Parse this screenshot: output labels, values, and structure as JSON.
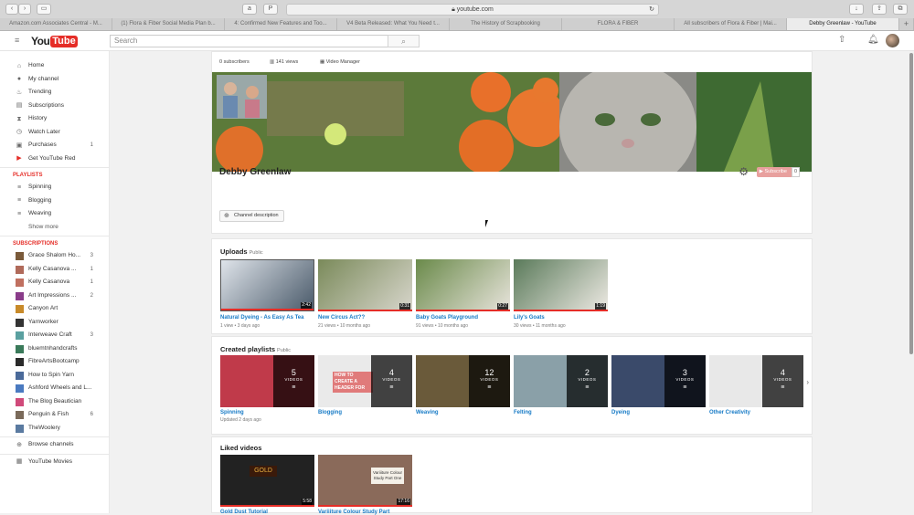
{
  "browser": {
    "url": "youtube.com",
    "tabs": [
      "Amazon.com Associates Central - M...",
      "(1) Flora & Fiber Social Media Plan b...",
      "4: Confirmed New Features and Too...",
      "V4 Beta Released: What You Need t...",
      "The History of Scrapbooking",
      "FLORA & FIBER",
      "All subscribers of Flora & Fiber | Mai...",
      "Debby Greenlaw - YouTube"
    ]
  },
  "header": {
    "logo_you": "You",
    "logo_tube": "Tube",
    "search_placeholder": "Search"
  },
  "sidebar": {
    "main": [
      {
        "label": "Home",
        "icon": "home-icon",
        "glyph": "⌂"
      },
      {
        "label": "My channel",
        "icon": "user-icon",
        "glyph": "●"
      },
      {
        "label": "Trending",
        "icon": "flame-icon",
        "glyph": "♨"
      },
      {
        "label": "Subscriptions",
        "icon": "subscriptions-icon",
        "glyph": "▤"
      },
      {
        "label": "History",
        "icon": "hourglass-icon",
        "glyph": "⧗"
      },
      {
        "label": "Watch Later",
        "icon": "clock-icon",
        "glyph": "◷"
      },
      {
        "label": "Purchases",
        "icon": "purchases-icon",
        "glyph": "▣",
        "count": "1"
      },
      {
        "label": "Get YouTube Red",
        "icon": "youtube-red-icon",
        "glyph": "▶"
      }
    ],
    "playlists_title": "PLAYLISTS",
    "playlists": [
      {
        "label": "Spinning"
      },
      {
        "label": "Blogging"
      },
      {
        "label": "Weaving"
      }
    ],
    "show_more": "Show more",
    "subscriptions_title": "SUBSCRIPTIONS",
    "subscriptions": [
      {
        "label": "Grace Shalom Ho...",
        "count": "3",
        "color": "#7a5a3a"
      },
      {
        "label": "Kelly Casanova ...",
        "count": "1",
        "color": "#b06a5a"
      },
      {
        "label": "Kelly Casanova",
        "count": "1",
        "color": "#c07060"
      },
      {
        "label": "Art Impressions ...",
        "count": "2",
        "color": "#8a3c8a"
      },
      {
        "label": "Canyon Art",
        "count": "",
        "color": "#c88a2a"
      },
      {
        "label": "Yarnworker",
        "count": "",
        "color": "#333333"
      },
      {
        "label": "Interweave Craft",
        "count": "3",
        "color": "#5aa0a0"
      },
      {
        "label": "bluemtnhandcrafts",
        "count": "",
        "color": "#3a7a5a"
      },
      {
        "label": "FibreArtsBootcamp",
        "count": "",
        "color": "#2a2a2a"
      },
      {
        "label": "How to Spin Yarn",
        "count": "",
        "color": "#4a6a9a"
      },
      {
        "label": "Ashford Wheels and L...",
        "count": "",
        "color": "#4a7ac0"
      },
      {
        "label": "The Blog Beautician",
        "count": "",
        "color": "#d04a7a"
      },
      {
        "label": "Penguin & Fish",
        "count": "6",
        "color": "#7a6a5a"
      },
      {
        "label": "TheWoolery",
        "count": "",
        "color": "#5a7aa0"
      }
    ],
    "browse_channels": "Browse channels",
    "youtube_movies": "YouTube Movies"
  },
  "channel": {
    "subscribers": "0 subscribers",
    "views": "141 views",
    "video_manager": "Video Manager",
    "name": "Debby Greenlaw",
    "subscribe_label": "Subscribe",
    "subscribe_count": "0",
    "description_button": "Channel description"
  },
  "uploads": {
    "title": "Uploads",
    "visibility": "Public",
    "videos": [
      {
        "title": "Natural Dyeing - As Easy As Tea",
        "meta": "1 view • 3 days ago",
        "duration": "2:42"
      },
      {
        "title": "New Circus Act??",
        "meta": "21 views • 10 months ago",
        "duration": "0:31"
      },
      {
        "title": "Baby Goats Playground",
        "meta": "91 views • 10 months ago",
        "duration": "0:27"
      },
      {
        "title": "Lily's Goats",
        "meta": "30 views • 11 months ago",
        "duration": "1:19"
      }
    ]
  },
  "playlists_section": {
    "title": "Created playlists",
    "visibility": "Public",
    "items": [
      {
        "title": "Spinning",
        "meta": "Updated 2 days ago",
        "count": "5",
        "unit": "VIDEOS"
      },
      {
        "title": "Blogging",
        "meta": "",
        "count": "4",
        "unit": "VIDEOS",
        "thumb_text": "HOW TO CREATE A HEADER FOR"
      },
      {
        "title": "Weaving",
        "meta": "",
        "count": "12",
        "unit": "VIDEOS"
      },
      {
        "title": "Felting",
        "meta": "",
        "count": "2",
        "unit": "VIDEOS"
      },
      {
        "title": "Dyeing",
        "meta": "",
        "count": "3",
        "unit": "VIDEOS"
      },
      {
        "title": "Other Creativity",
        "meta": "",
        "count": "4",
        "unit": "VIDEOS"
      }
    ]
  },
  "liked": {
    "title": "Liked videos",
    "videos": [
      {
        "title": "Gold Dust Tutorial",
        "duration": "5:58",
        "thumb_text": "GOLD"
      },
      {
        "title": "Variiiture Colour Study Part",
        "duration": "17:16",
        "thumb_text": "Variiiture Colour Study Part One"
      }
    ]
  }
}
